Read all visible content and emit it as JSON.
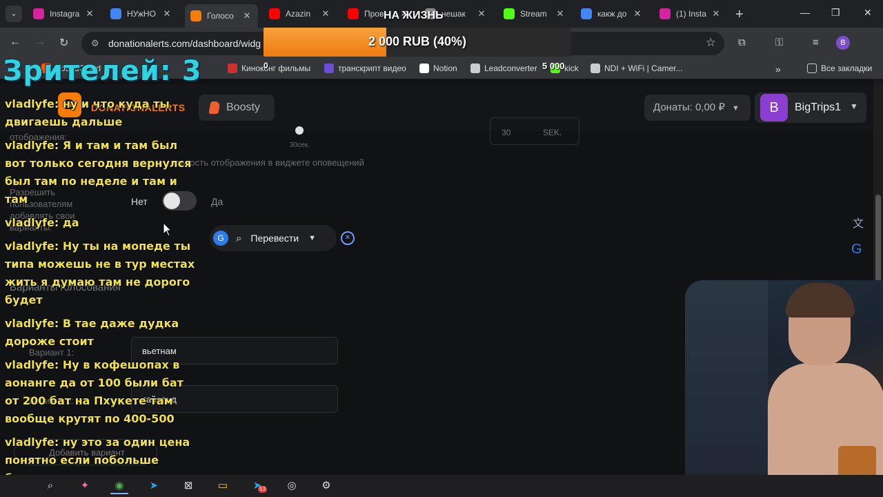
{
  "browser": {
    "tabs": [
      {
        "label": "Instagra",
        "favicon": "instagram-icon",
        "color": "#d6249f",
        "active": false
      },
      {
        "label": "НУжНО",
        "favicon": "google-icon",
        "color": "#4285f4",
        "active": false
      },
      {
        "label": "Голосо",
        "favicon": "donationalerts-icon",
        "color": "#f57d07",
        "active": true
      },
      {
        "label": "Azazin",
        "favicon": "youtube-icon",
        "color": "#ff0000",
        "active": false
      },
      {
        "label": "Пров",
        "favicon": "youtube-icon",
        "color": "#ff0000",
        "active": false
      },
      {
        "label": "нешак",
        "favicon": "page-icon",
        "color": "#888888",
        "active": false
      },
      {
        "label": "Stream",
        "favicon": "kick-icon",
        "color": "#53fc18",
        "active": false
      },
      {
        "label": "какж до",
        "favicon": "google-icon",
        "color": "#4285f4",
        "active": false
      },
      {
        "label": "(1) Insta",
        "favicon": "instagram-icon",
        "color": "#d6249f",
        "active": false
      }
    ],
    "url": "donationalerts.com/dashboard/widg",
    "profile_letter": "B",
    "bookmarks": [
      {
        "label": "SoundCloud",
        "icon": "soundcloud-icon",
        "color": "#ff5500"
      },
      {
        "label": "Киноконг фильмы",
        "icon": "film-icon",
        "color": "#d03030"
      },
      {
        "label": "транскрипт видео",
        "icon": "grid-icon",
        "color": "#6b4fd8"
      },
      {
        "label": "Notion",
        "icon": "notion-icon",
        "color": "#ffffff"
      },
      {
        "label": "Leadconverter",
        "icon": "leadconverter-icon",
        "color": "#cccccc"
      },
      {
        "label": "kick",
        "icon": "kick-icon",
        "color": "#53fc18"
      },
      {
        "label": "NDI + WiFi | Camer...",
        "icon": "globe-icon",
        "color": "#cccccc"
      }
    ],
    "all_bookmarks_label": "Все закладки"
  },
  "site": {
    "brand": "DONATIONALERTS",
    "boosty_label": "Boosty",
    "donates_label": "Донаты: 0,00 ₽",
    "user_initial": "B",
    "user_name": "BigTrips1",
    "duration_hint": "30сек.",
    "duration_caption": "льность отображения в виджете оповещений",
    "display_label": "отображения:",
    "duration_value": "30",
    "duration_unit": "SEK.",
    "allow_label": "Разрешить пользователям добавлять свои варианты:",
    "toggle_no": "Нет",
    "toggle_yes": "Да",
    "toggle_on": false,
    "options_label": "Варианты голосования",
    "option1_label": "Вариант 1:",
    "option1_value": "вьетнам",
    "option2_label": "Вариант 2:",
    "option2_value": "тайланд",
    "add_option_label": "Добавить вариант"
  },
  "translate": {
    "label": "Перевести"
  },
  "overlay": {
    "viewers": "Зрителей: 3",
    "goal_title": "НА ЖИЗНЬ",
    "goal_text": "2 000 RUB (40%)",
    "goal_progress": 0.4,
    "goal_min": "0",
    "goal_max": "5 000",
    "chat": [
      {
        "author": "vladlyfe:",
        "text": "ну и что куда ты двигаешь дальше"
      },
      {
        "author": "vladlyfe:",
        "text": "Я и там и там был вот только сегодня вернулся был там по неделе и там и там"
      },
      {
        "author": "vladlyfe:",
        "text": "да"
      },
      {
        "author": "vladlyfe:",
        "text": "Ну ты на мопеде ты типа можешь не в тур местах жить я думаю там не дорого будет"
      },
      {
        "author": "vladlyfe:",
        "text": "В тае даже дудка дороже стоит"
      },
      {
        "author": "vladlyfe:",
        "text": "Ну в кофешопах в аонанге да от 100 были бат от 200 бат на Пхукете там вообще крутят по 400-500"
      },
      {
        "author": "vladlyfe:",
        "text": "ну это за один цена понятно если побольше брать"
      }
    ]
  },
  "taskbar": {
    "telegram_badge": "53"
  }
}
